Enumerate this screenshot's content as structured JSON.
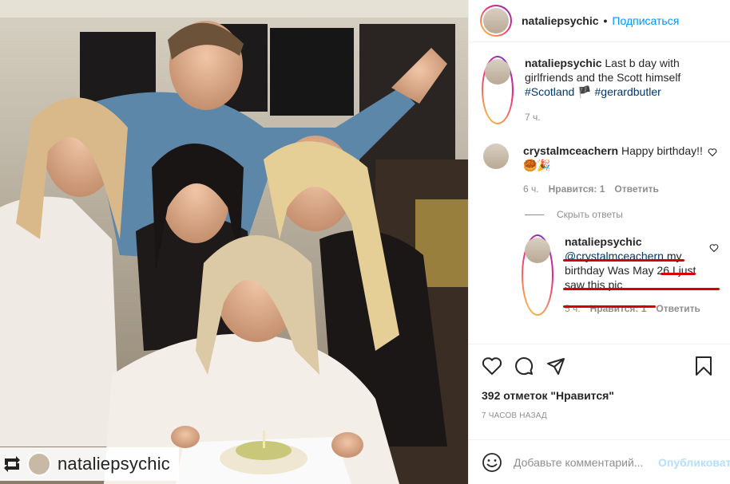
{
  "photo": {
    "repost_username": "nataliepsychic"
  },
  "header": {
    "username": "nataliepsychic",
    "separator": "•",
    "follow_label": "Подписаться"
  },
  "caption": {
    "username": "nataliepsychic",
    "text_before": "Last b day with girlfriends and the Scott himself",
    "hashtag1": "#Scotland",
    "flag": "🏴",
    "hashtag2": "#gerardbutler",
    "time": "7 ч."
  },
  "comments": [
    {
      "username": "crystalmceachern",
      "text": "Happy birthday!!",
      "emoji": "🥮🎉",
      "time": "6 ч.",
      "likes": "Нравится: 1",
      "reply": "Ответить"
    }
  ],
  "hide_replies_label": "Скрыть ответы",
  "reply": {
    "username": "nataliepsychic",
    "mention": "@crystalmceachern",
    "text": "my birthday Was May 26 I just saw this pic",
    "time": "5 ч.",
    "likes": "Нравится: 1",
    "reply": "Ответить"
  },
  "actions": {
    "likes_count": "392 отметок \"Нравится\"",
    "posted_ago": "7 часов назад"
  },
  "add_comment": {
    "placeholder": "Добавьте комментарий...",
    "post_label": "Опубликовать"
  },
  "colors": {
    "link": "#00376b",
    "follow": "#0095f6",
    "muted": "#8e8e8e",
    "annotation": "#d40000"
  }
}
